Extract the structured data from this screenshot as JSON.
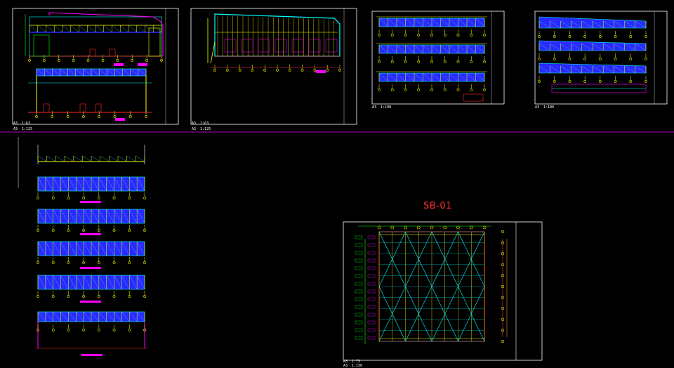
{
  "drawing_title": "SB-01",
  "sheets": {
    "sheet1": {
      "label_1": "A3  1:63",
      "label_2": "A3  1:125"
    },
    "sheet2": {
      "label_1": "A3  1:63",
      "label_2": "A3  1:125"
    },
    "sheet3": {
      "label_1": "A3  1:100"
    },
    "sheet4": {
      "label_1": "A3  1:100"
    },
    "sheet5": {
      "label_1": "A3  1:75",
      "label_2": "A3  1:150"
    }
  },
  "colors": {
    "background": "#000000",
    "frame": "#ffffff",
    "divider": "#b000b0",
    "steel": "#2a2aff",
    "grid": "#00ffff",
    "member": "#ffff00",
    "dimension": "#ff2a2a",
    "magenta": "#ff00ff",
    "green": "#00ff00",
    "title": "#ff2a2a"
  }
}
